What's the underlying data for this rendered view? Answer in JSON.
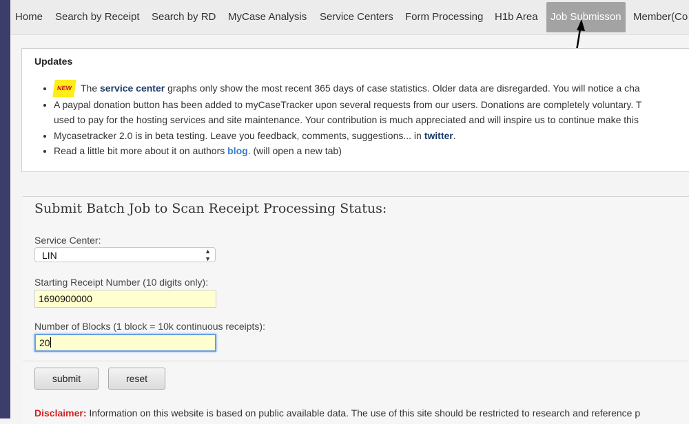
{
  "nav": {
    "items": [
      {
        "label": "Home"
      },
      {
        "label": "Search by Receipt"
      },
      {
        "label": "Search by RD"
      },
      {
        "label": "MyCase Analysis"
      },
      {
        "label": "Service Centers"
      },
      {
        "label": "Form Processing"
      },
      {
        "label": "H1b Area"
      },
      {
        "label": "Job Submisson",
        "active": true
      },
      {
        "label": "Member(Co"
      }
    ]
  },
  "updates": {
    "title": "Updates",
    "new_badge": "NEW",
    "item1": {
      "pre": "The ",
      "link": "service center",
      "post": " graphs only show the most recent 365 days of case statistics. Older data are disregarded. You will notice a cha"
    },
    "item2": {
      "line1": "A paypal donation button has been added to myCaseTracker upon several requests from our users. Donations are completely voluntary. T",
      "line2": "used to pay for the hosting services and site maintenance. Your contribution is much appreciated and will inspire us to continue make this"
    },
    "item3": {
      "pre": "Mycasetracker 2.0 is in beta testing. Leave you feedback, comments, suggestions... in ",
      "link": "twitter",
      "post": "."
    },
    "item4": {
      "pre": "Read a little bit more about it on authors ",
      "link": "blog",
      "post": ". (will open a new tab)"
    }
  },
  "form": {
    "title": "Submit Batch Job to Scan Receipt Processing Status:",
    "service_center_label": "Service Center:",
    "service_center_value": "LIN",
    "receipt_label": "Starting Receipt Number (10 digits only):",
    "receipt_value": "1690900000",
    "blocks_label": "Number of Blocks (1 block = 10k continuous receipts):",
    "blocks_value": "20",
    "submit_label": "submit",
    "reset_label": "reset"
  },
  "disclaimer": {
    "label": "Disclaimer:",
    "text": " Information on this website is based on public available data. The use of this site should be restricted to research and reference p"
  },
  "colors": {
    "nav_active": "#a3a3a3",
    "disclaimer": "#d22020",
    "field_bg": "#ffffcf"
  }
}
